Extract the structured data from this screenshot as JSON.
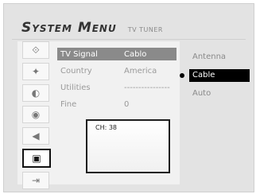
{
  "header": {
    "title": "System Menu",
    "subtitle": "TV TUNER"
  },
  "icons": [
    {
      "name": "network-icon",
      "glyph": "⟐"
    },
    {
      "name": "satellite-icon",
      "glyph": "✦"
    },
    {
      "name": "disc-icon",
      "glyph": "◐"
    },
    {
      "name": "link-icon",
      "glyph": "◉"
    },
    {
      "name": "speaker-icon",
      "glyph": "◀"
    },
    {
      "name": "tv-icon",
      "glyph": "▣"
    },
    {
      "name": "exit-icon",
      "glyph": "⇥"
    }
  ],
  "settings": [
    {
      "label": "TV Signal",
      "value": "Cablo"
    },
    {
      "label": "Country",
      "value": "America"
    },
    {
      "label": "Utilities",
      "value": "----------------"
    },
    {
      "label": "Fine",
      "value": "0"
    }
  ],
  "preview": {
    "channel": "CH: 38"
  },
  "options": [
    "Antenna",
    "Cable",
    "Auto"
  ]
}
